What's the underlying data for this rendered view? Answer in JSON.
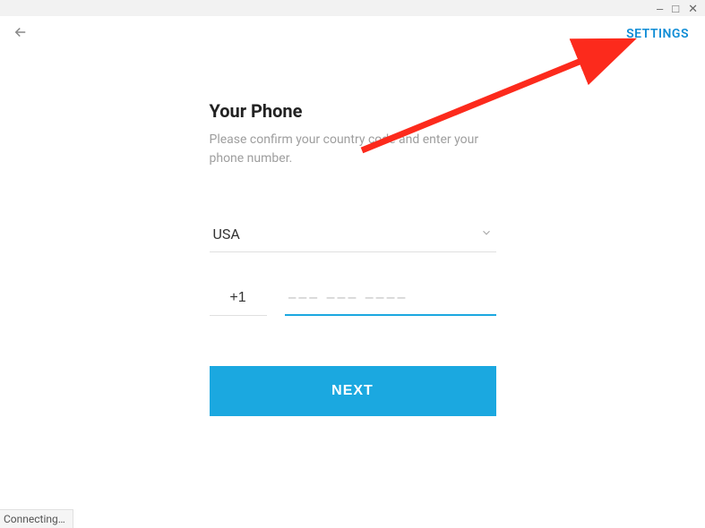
{
  "window": {
    "minimize": "–",
    "maximize": "□",
    "close": "✕"
  },
  "header": {
    "settings_label": "SETTINGS"
  },
  "form": {
    "title": "Your Phone",
    "subtitle": "Please confirm your country code and enter your phone number.",
    "country": "USA",
    "country_code": "+1",
    "phone_placeholder": "––– ––– ––––",
    "next_label": "NEXT"
  },
  "status": {
    "text": "Connecting…"
  },
  "colors": {
    "accent": "#1ba8e0",
    "link": "#0f8dd6",
    "annotation": "#fc2a1c"
  }
}
